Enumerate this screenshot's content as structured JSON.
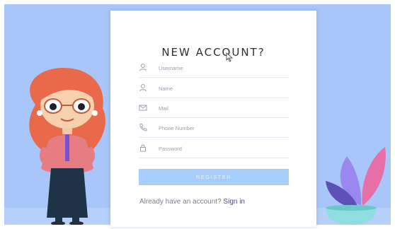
{
  "form": {
    "title": "NEW ACCOUNT?",
    "fields": [
      {
        "placeholder": "Username",
        "icon": "user-icon"
      },
      {
        "placeholder": "Name",
        "icon": "user-icon"
      },
      {
        "placeholder": "Mail",
        "icon": "mail-icon"
      },
      {
        "placeholder": "Phone Number",
        "icon": "phone-icon"
      },
      {
        "placeholder": "Password",
        "icon": "lock-icon"
      }
    ],
    "register_label": "REGISTER",
    "footer_text": "Already have an account? ",
    "signin_label": "Sign in"
  },
  "colors": {
    "background": "#a9c6fa",
    "button": "#a6cdfb",
    "link": "#4b3fa8"
  }
}
